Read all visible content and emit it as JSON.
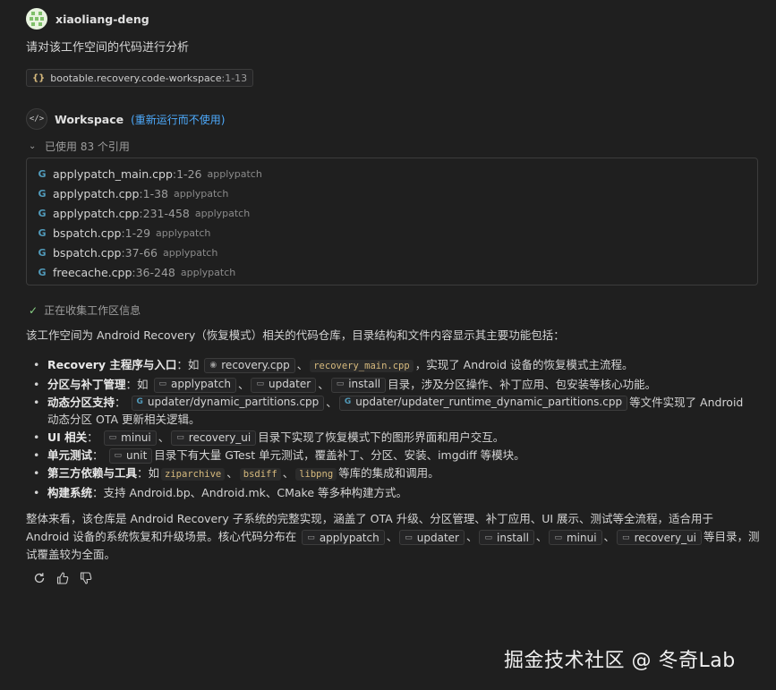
{
  "user": {
    "name": "xiaoliang-deng",
    "avatar_icon": "identicon-avatar"
  },
  "prompt": "请对该工作空间的代码进行分析",
  "attached_file": {
    "name": "bootable.recovery.code-workspace",
    "range": ":1-13"
  },
  "workspace": {
    "title": "Workspace",
    "rerun_link": "(重新运行而不使用)"
  },
  "references": {
    "toggle_label": "已使用 83 个引用",
    "items": [
      {
        "file": "applypatch_main.cpp",
        "range": ":1-26",
        "dir": "applypatch"
      },
      {
        "file": "applypatch.cpp",
        "range": ":1-38",
        "dir": "applypatch"
      },
      {
        "file": "applypatch.cpp",
        "range": ":231-458",
        "dir": "applypatch"
      },
      {
        "file": "bspatch.cpp",
        "range": ":1-29",
        "dir": "applypatch"
      },
      {
        "file": "bspatch.cpp",
        "range": ":37-66",
        "dir": "applypatch"
      },
      {
        "file": "freecache.cpp",
        "range": ":36-248",
        "dir": "applypatch"
      }
    ]
  },
  "status": "正在收集工作区信息",
  "intro": "该工作空间为 Android Recovery（恢复模式）相关的代码仓库，目录结构和文件内容显示其主要功能包括：",
  "bullets": {
    "b1": {
      "title": "Recovery 主程序与入口",
      "t1": "：如",
      "chip1": "recovery.cpp",
      "sep": "、",
      "code1": "recovery_main.cpp",
      "t2": "，实现了 Android 设备的恢复模式主流程。"
    },
    "b2": {
      "title": "分区与补丁管理",
      "t1": "：如",
      "chip1": "applypatch",
      "sep1": "、",
      "chip2": "updater",
      "sep2": "、",
      "chip3": "install",
      "t2": "目录，涉及分区操作、补丁应用、包安装等核心功能。"
    },
    "b3": {
      "title": "动态分区支持",
      "t1": "：",
      "chip1": "updater/dynamic_partitions.cpp",
      "sep": "、",
      "chip2": "updater/updater_runtime_dynamic_partitions.cpp",
      "t2": "等文件实现了 Android 动态分区 OTA 更新相关逻辑。"
    },
    "b4": {
      "title": "UI 相关",
      "t1": "：",
      "chip1": "minui",
      "sep": "、",
      "chip2": "recovery_ui",
      "t2": "目录下实现了恢复模式下的图形界面和用户交互。"
    },
    "b5": {
      "title": "单元测试",
      "t1": "：",
      "chip1": "unit",
      "t2": "目录下有大量 GTest 单元测试，覆盖补丁、分区、安装、imgdiff 等模块。"
    },
    "b6": {
      "title": "第三方依赖与工具",
      "t1": "：如",
      "code1": "ziparchive",
      "sep1": "、",
      "code2": "bsdiff",
      "sep2": "、",
      "code3": "libpng",
      "t2": "等库的集成和调用。"
    },
    "b7": {
      "title": "构建系统",
      "t1": "：支持 Android.bp、Android.mk、CMake 等多种构建方式。"
    }
  },
  "summary": {
    "t1": "整体来看，该仓库是 Android Recovery 子系统的完整实现，涵盖了 OTA 升级、分区管理、补丁应用、UI 展示、测试等全流程，适合用于 Android 设备的系统恢复和升级场景。核心代码分布在",
    "chip1": "applypatch",
    "sep1": "、",
    "chip2": "updater",
    "sep2": "、",
    "chip3": "install",
    "sep3": "、",
    "chip4": "minui",
    "sep4": "、",
    "chip5": "recovery_ui",
    "t2": "等目录，测试覆盖较为全面。"
  },
  "actions": {
    "retry_icon": "retry-icon",
    "thumbs_up_icon": "thumbs-up-icon",
    "thumbs_down_icon": "thumbs-down-icon"
  },
  "watermark": "掘金技术社区 @ 冬奇Lab",
  "colors": {
    "background": "#1f1f1f",
    "link": "#4daafc",
    "cpp_icon": "#519aba",
    "code_text": "#d7ba7d",
    "check": "#89d185"
  }
}
